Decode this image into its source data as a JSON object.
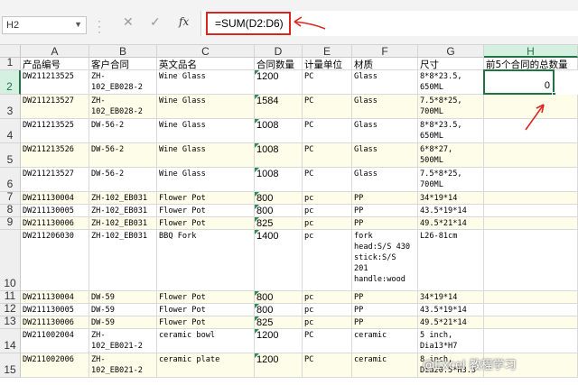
{
  "formula_bar": {
    "name_box": "H2",
    "cancel_icon": "✕",
    "enter_icon": "✓",
    "fx_label": "fx",
    "formula": "=SUM(D2:D6)"
  },
  "columns": [
    "A",
    "B",
    "C",
    "D",
    "E",
    "F",
    "G",
    "H"
  ],
  "selected_column": "H",
  "headers": {
    "a": "产品编号",
    "b": "客户合同",
    "c": "英文品名",
    "d": "合同数量",
    "e": "计量单位",
    "f": "材质",
    "g": "尺寸",
    "h": "前5个合同的总数量"
  },
  "rows": [
    {
      "num": "2",
      "a": "DW211213525",
      "b": "ZH-\n102_EB028-2",
      "c": "Wine Glass",
      "d": "1200",
      "e": "PC",
      "f": "Glass",
      "g": "8*8*23.5,\n650ML",
      "h": "0"
    },
    {
      "num": "3",
      "a": "DW211213527",
      "b": "ZH-\n102_EB028-2",
      "c": "Wine Glass",
      "d": "1584",
      "e": "PC",
      "f": "Glass",
      "g": "7.5*8*25,\n700ML",
      "h": ""
    },
    {
      "num": "4",
      "a": "DW211213525",
      "b": "DW-56-2",
      "c": "Wine Glass",
      "d": "1008",
      "e": "PC",
      "f": "Glass",
      "g": "8*8*23.5,\n650ML",
      "h": ""
    },
    {
      "num": "5",
      "a": "DW211213526",
      "b": "DW-56-2",
      "c": "Wine Glass",
      "d": "1008",
      "e": "PC",
      "f": "Glass",
      "g": "6*8*27,\n500ML",
      "h": ""
    },
    {
      "num": "6",
      "a": "DW211213527",
      "b": "DW-56-2",
      "c": "Wine Glass",
      "d": "1008",
      "e": "PC",
      "f": "Glass",
      "g": "7.5*8*25,\n700ML",
      "h": ""
    },
    {
      "num": "7",
      "a": "DW211130004",
      "b": "ZH-102_EB031",
      "c": "Flower Pot",
      "d": "800",
      "e": "pc",
      "f": "PP",
      "g": "34*19*14",
      "h": ""
    },
    {
      "num": "8",
      "a": "DW211130005",
      "b": "ZH-102_EB031",
      "c": "Flower Pot",
      "d": "800",
      "e": "pc",
      "f": "PP",
      "g": "43.5*19*14",
      "h": ""
    },
    {
      "num": "9",
      "a": "DW211130006",
      "b": "ZH-102_EB031",
      "c": "Flower Pot",
      "d": "825",
      "e": "pc",
      "f": "PP",
      "g": "49.5*21*14",
      "h": ""
    },
    {
      "num": "10",
      "a": "DW211206030",
      "b": "ZH-102_EB031",
      "c": "BBQ Fork",
      "d": "1400",
      "e": "pc",
      "f": "fork\nhead:S/S 430\nstick:S/S\n201\nhandle:wood",
      "g": "L26-81cm",
      "h": ""
    },
    {
      "num": "11",
      "a": "DW211130004",
      "b": "DW-59",
      "c": "Flower Pot",
      "d": "800",
      "e": "pc",
      "f": "PP",
      "g": "34*19*14",
      "h": ""
    },
    {
      "num": "12",
      "a": "DW211130005",
      "b": "DW-59",
      "c": "Flower Pot",
      "d": "800",
      "e": "pc",
      "f": "PP",
      "g": "43.5*19*14",
      "h": ""
    },
    {
      "num": "13",
      "a": "DW211130006",
      "b": "DW-59",
      "c": "Flower Pot",
      "d": "825",
      "e": "pc",
      "f": "PP",
      "g": "49.5*21*14",
      "h": ""
    },
    {
      "num": "14",
      "a": "DW211002004",
      "b": "ZH-\n102_EB021-2",
      "c": "ceramic bowl",
      "d": "1200",
      "e": "PC",
      "f": "ceramic",
      "g": "5 inch,\nDia13*H7",
      "h": ""
    },
    {
      "num": "15",
      "a": "DW211002006",
      "b": "ZH-\n102_EB021-2",
      "c": "ceramic plate",
      "d": "1200",
      "e": "PC",
      "f": "ceramic",
      "g": "8 inch,\nDia20.5*H3.5",
      "h": ""
    }
  ],
  "watermark": "@Excel 教程学习",
  "colors": {
    "accent": "#217346",
    "annotation": "#d9271f",
    "band": "#fefde9"
  }
}
